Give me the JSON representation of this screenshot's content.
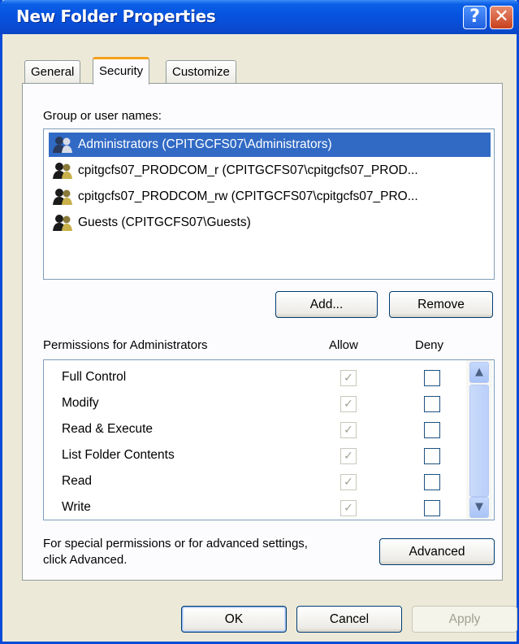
{
  "window": {
    "title": "New Folder Properties"
  },
  "tabs": [
    {
      "label": "General",
      "active": false
    },
    {
      "label": "Security",
      "active": true
    },
    {
      "label": "Customize",
      "active": false
    }
  ],
  "group_label": "Group or user names:",
  "users": [
    {
      "name": "Administrators (CPITGCFS07\\Administrators)",
      "selected": true
    },
    {
      "name": "cpitgcfs07_PRODCOM_r (CPITGCFS07\\cpitgcfs07_PROD...",
      "selected": false
    },
    {
      "name": "cpitgcfs07_PRODCOM_rw (CPITGCFS07\\cpitgcfs07_PRO...",
      "selected": false
    },
    {
      "name": "Guests (CPITGCFS07\\Guests)",
      "selected": false
    }
  ],
  "buttons": {
    "add": "Add...",
    "remove": "Remove",
    "advanced": "Advanced",
    "ok": "OK",
    "cancel": "Cancel",
    "apply": "Apply"
  },
  "permissions_header": {
    "label": "Permissions for Administrators",
    "allow": "Allow",
    "deny": "Deny"
  },
  "permissions": [
    {
      "name": "Full Control",
      "allow": true,
      "deny": false
    },
    {
      "name": "Modify",
      "allow": true,
      "deny": false
    },
    {
      "name": "Read & Execute",
      "allow": true,
      "deny": false
    },
    {
      "name": "List Folder Contents",
      "allow": true,
      "deny": false
    },
    {
      "name": "Read",
      "allow": true,
      "deny": false
    },
    {
      "name": "Write",
      "allow": true,
      "deny": false
    }
  ],
  "advanced_text": {
    "line1": "For special permissions or for advanced settings,",
    "line2": "click Advanced."
  },
  "icons": {
    "help": "?",
    "close": "✕",
    "check": "✓",
    "scroll_up": "▲",
    "scroll_down": "▼"
  },
  "colors": {
    "titlebar": "#0553e0",
    "selection": "#316ac5",
    "active_tab_accent": "#f5a11c"
  }
}
